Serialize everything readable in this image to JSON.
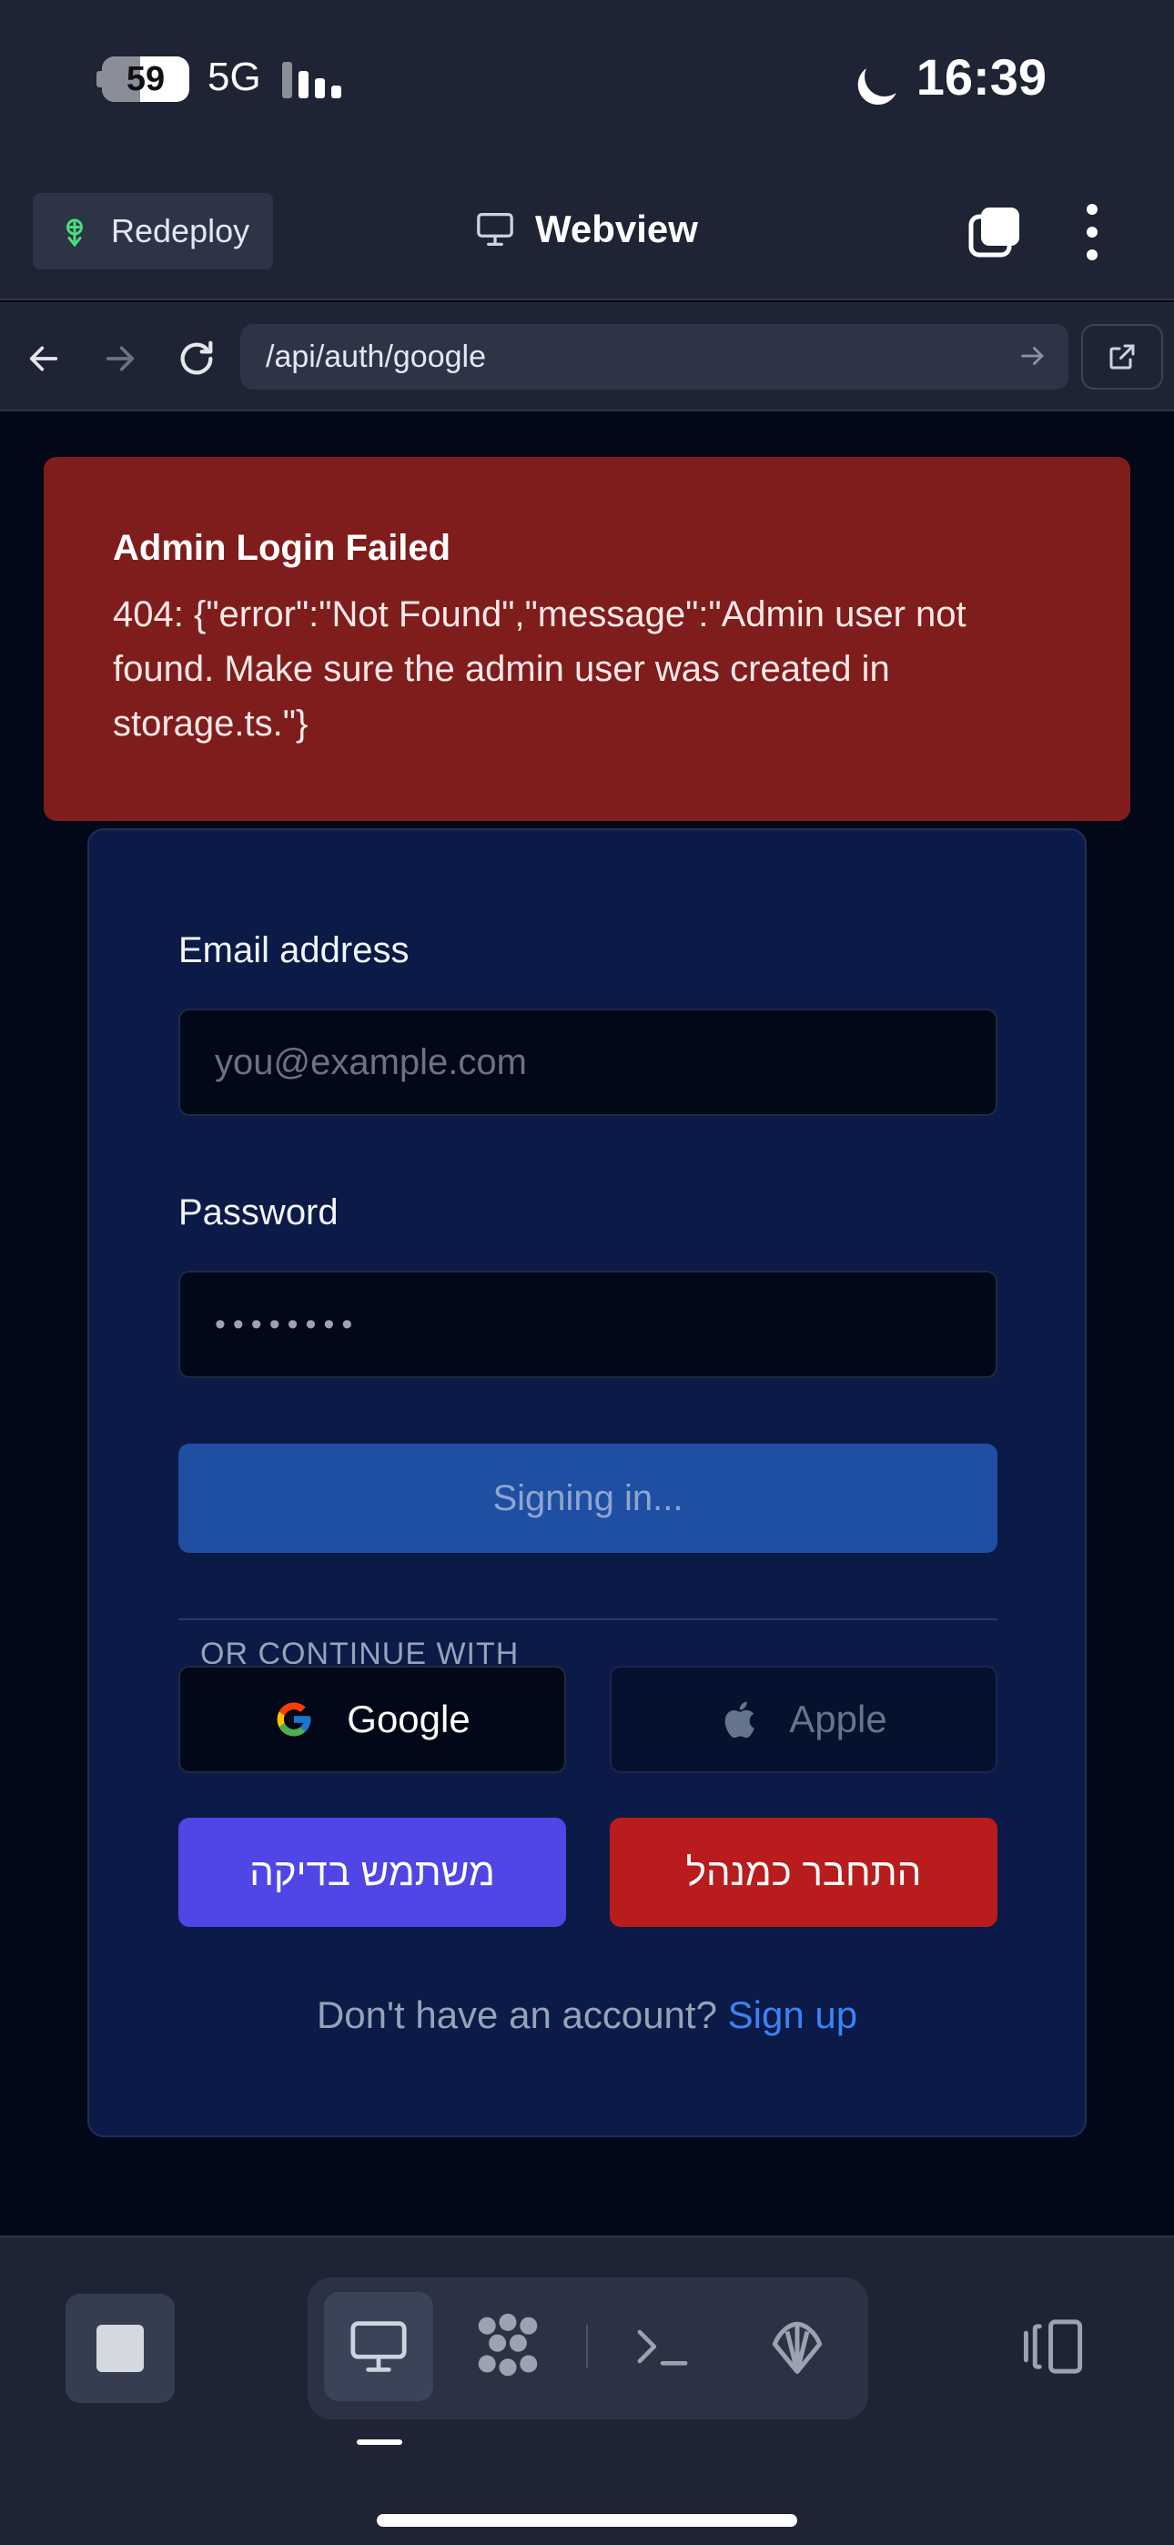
{
  "status_bar": {
    "battery": "59",
    "network": "5G",
    "time": "16:39"
  },
  "app_header": {
    "redeploy_label": "Redeploy",
    "title": "Webview"
  },
  "browser": {
    "url": "/api/auth/google"
  },
  "error": {
    "title": "Admin Login Failed",
    "message": "404: {\"error\":\"Not Found\",\"message\":\"Admin user not found. Make sure the admin user was created in storage.ts.\"}"
  },
  "login": {
    "email_label": "Email address",
    "email_placeholder": "you@example.com",
    "password_label": "Password",
    "password_value": "••••••••",
    "signin_label": "Signing in...",
    "or_text": "OR CONTINUE WITH",
    "google_label": "Google",
    "apple_label": "Apple",
    "demo_user_label": "משתמש בדיקה",
    "admin_login_label": "התחבר כמנהל",
    "no_account_text": "Don't have an account?",
    "signup_label": "Sign up"
  },
  "colors": {
    "accent": "#3b82f6",
    "error_bg": "#7f1d1d",
    "card_bg": "#0b1a47",
    "demo_button": "#4f46e5",
    "admin_button": "#b91c1c",
    "signin_button": "#1f4fa3"
  },
  "icons": {
    "redeploy": "rocket-icon",
    "webview": "monitor-icon",
    "tabs": "tabs-icon",
    "more": "more-vertical-icon",
    "back": "arrow-left-icon",
    "forward": "arrow-right-icon",
    "reload": "reload-icon",
    "external": "external-link-icon",
    "google": "google-icon",
    "apple": "apple-icon",
    "stop": "stop-icon",
    "preview": "monitor-icon",
    "agent": "agent-icon",
    "shell": "terminal-icon",
    "secrets": "shell-icon",
    "panel": "panel-toggle-icon"
  }
}
